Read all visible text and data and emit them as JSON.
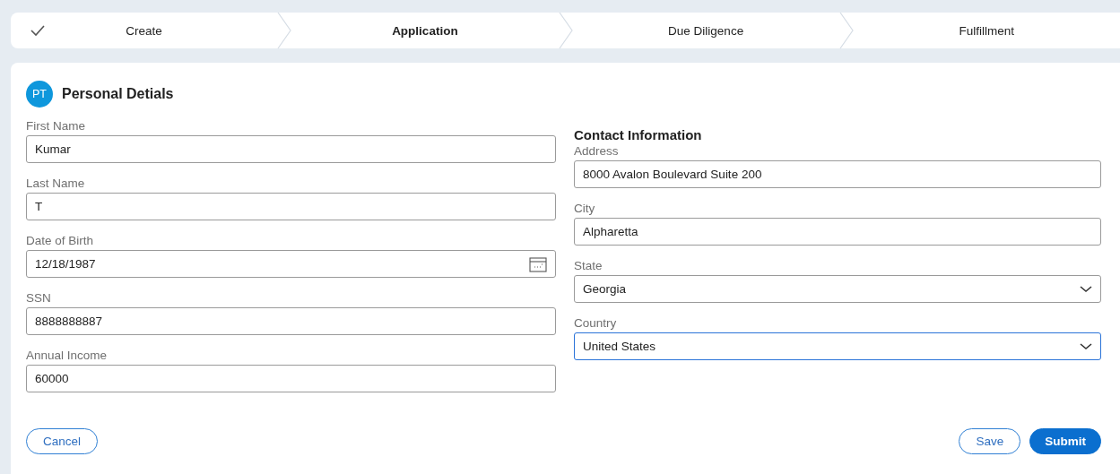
{
  "stages": [
    {
      "label": "Create",
      "completed": true,
      "selected": false
    },
    {
      "label": "Application",
      "completed": false,
      "selected": true
    },
    {
      "label": "Due Diligence",
      "completed": false,
      "selected": false
    },
    {
      "label": "Fulfillment",
      "completed": false,
      "selected": false
    }
  ],
  "section": {
    "badge": "PT",
    "title": "Personal Detials"
  },
  "left_fields": [
    {
      "label": "First Name",
      "value": "Kumar",
      "kind": "text",
      "focused": false
    },
    {
      "label": "Last Name",
      "value": "T",
      "kind": "text",
      "focused": false
    },
    {
      "label": "Date of Birth",
      "value": "12/18/1987",
      "kind": "date",
      "focused": false
    },
    {
      "label": "SSN",
      "value": "8888888887",
      "kind": "text",
      "focused": false
    },
    {
      "label": "Annual Income",
      "value": "60000",
      "kind": "text",
      "focused": false
    }
  ],
  "contact": {
    "title": "Contact Information",
    "fields": [
      {
        "label": "Address",
        "value": "8000 Avalon Boulevard Suite 200",
        "kind": "text",
        "focused": false
      },
      {
        "label": "City",
        "value": "Alpharetta",
        "kind": "text",
        "focused": false
      },
      {
        "label": "State",
        "value": "Georgia",
        "kind": "select",
        "focused": false
      },
      {
        "label": "Country",
        "value": "United States",
        "kind": "select",
        "focused": true
      }
    ]
  },
  "buttons_left": [
    {
      "label": "Cancel",
      "kind": "secondary"
    }
  ],
  "buttons_right": [
    {
      "label": "Save",
      "kind": "secondary"
    },
    {
      "label": "Submit",
      "kind": "primary"
    }
  ]
}
